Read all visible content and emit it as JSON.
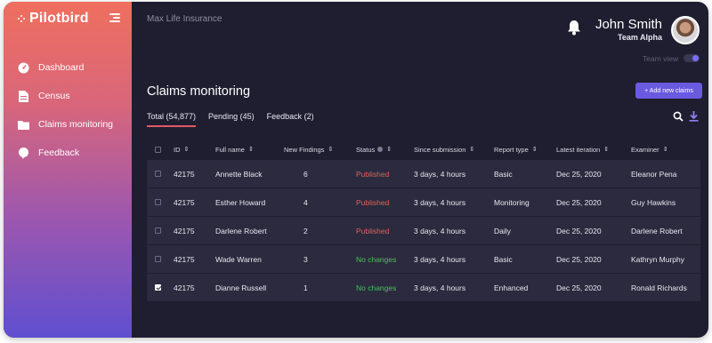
{
  "app": {
    "logo": "Pilotbird"
  },
  "sidebar": {
    "items": [
      {
        "label": "Dashboard",
        "icon": "dashboard-icon"
      },
      {
        "label": "Census",
        "icon": "document-icon"
      },
      {
        "label": "Claims monitoring",
        "icon": "folder-icon"
      },
      {
        "label": "Feedback",
        "icon": "chat-bubble-icon"
      }
    ]
  },
  "header": {
    "company": "Max Life Insurance",
    "user_name": "John Smith",
    "user_team": "Team Alpha",
    "team_view_label": "Team view"
  },
  "page": {
    "title": "Claims monitoring",
    "add_button": "+ Add new claims",
    "tabs": [
      {
        "label": "Total (54,877)",
        "active": true
      },
      {
        "label": "Pending (45)",
        "active": false
      },
      {
        "label": "Feedback (2)",
        "active": false
      }
    ]
  },
  "table": {
    "columns": [
      "ID",
      "Full name",
      "New Findings",
      "Status",
      "Since submission",
      "Report type",
      "Latest iteration",
      "Examiner"
    ],
    "rows": [
      {
        "id": "42175",
        "name": "Annette Black",
        "findings": "6",
        "status": "Published",
        "since": "3 days, 4 hours",
        "type": "Basic",
        "iteration": "Dec 25, 2020",
        "examiner": "Eleanor Pena",
        "checked": false
      },
      {
        "id": "42175",
        "name": "Esther Howard",
        "findings": "4",
        "status": "Published",
        "since": "3 days, 4 hours",
        "type": "Monitoring",
        "iteration": "Dec 25, 2020",
        "examiner": "Guy Hawkins",
        "checked": false
      },
      {
        "id": "42175",
        "name": "Darlene Robert",
        "findings": "2",
        "status": "Published",
        "since": "3 days, 4 hours",
        "type": "Daily",
        "iteration": "Dec 25, 2020",
        "examiner": "Darlene Robert",
        "checked": false
      },
      {
        "id": "42175",
        "name": "Wade Warren",
        "findings": "3",
        "status": "No changes",
        "since": "3 days, 4 hours",
        "type": "Basic",
        "iteration": "Dec 25, 2020",
        "examiner": "Kathryn Murphy",
        "checked": false
      },
      {
        "id": "42175",
        "name": "Dianne Russell",
        "findings": "1",
        "status": "No changes",
        "since": "3 days, 4 hours",
        "type": "Enhanced",
        "iteration": "Dec 25, 2020",
        "examiner": "Ronald Richards",
        "checked": true
      }
    ]
  },
  "colors": {
    "accent": "#6a5ae0",
    "published": "#d8645c",
    "no_changes": "#4ec15a",
    "background": "#1f1e30"
  }
}
